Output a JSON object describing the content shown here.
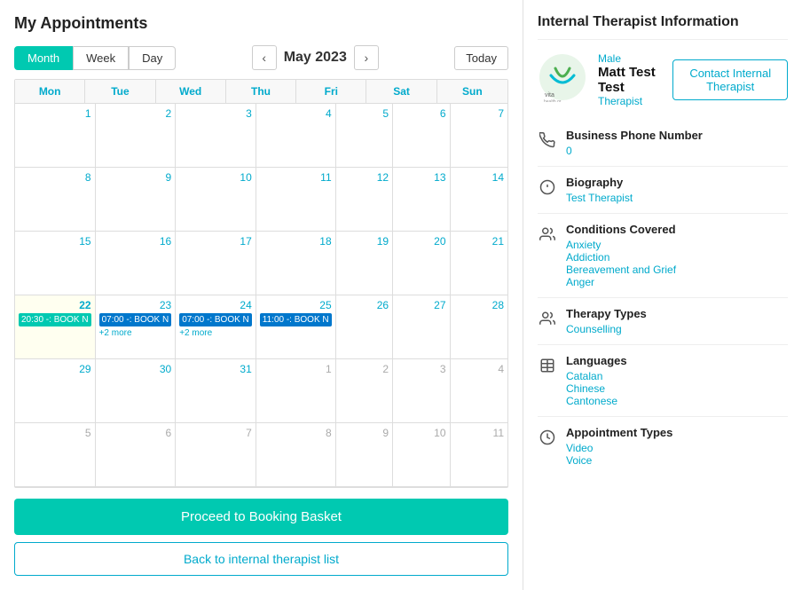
{
  "left": {
    "title": "My Appointments",
    "views": [
      "Month",
      "Week",
      "Day"
    ],
    "active_view": "Month",
    "month_label": "May 2023",
    "nav": {
      "prev": "‹",
      "next": "›",
      "today": "Today"
    },
    "days_header": [
      "Mon",
      "Tue",
      "Wed",
      "Thu",
      "Fri",
      "Sat",
      "Sun"
    ],
    "weeks": [
      [
        {
          "date": "1",
          "events": [],
          "other": false
        },
        {
          "date": "2",
          "events": [],
          "other": false
        },
        {
          "date": "3",
          "events": [],
          "other": false
        },
        {
          "date": "4",
          "events": [],
          "other": false
        },
        {
          "date": "5",
          "events": [],
          "other": false
        },
        {
          "date": "6",
          "events": [],
          "other": false
        },
        {
          "date": "7",
          "events": [],
          "other": false
        }
      ],
      [
        {
          "date": "8",
          "events": [],
          "other": false
        },
        {
          "date": "9",
          "events": [],
          "other": false
        },
        {
          "date": "10",
          "events": [],
          "other": false
        },
        {
          "date": "11",
          "events": [],
          "other": false
        },
        {
          "date": "12",
          "events": [],
          "other": false
        },
        {
          "date": "13",
          "events": [],
          "other": false
        },
        {
          "date": "14",
          "events": [],
          "other": false
        }
      ],
      [
        {
          "date": "15",
          "events": [],
          "other": false
        },
        {
          "date": "16",
          "events": [],
          "other": false
        },
        {
          "date": "17",
          "events": [],
          "other": false
        },
        {
          "date": "18",
          "events": [],
          "other": false
        },
        {
          "date": "19",
          "events": [],
          "other": false
        },
        {
          "date": "20",
          "events": [],
          "other": false
        },
        {
          "date": "21",
          "events": [],
          "other": false
        }
      ],
      [
        {
          "date": "22",
          "today": true,
          "events": [
            {
              "label": "20:30 -: BOOK N",
              "color": "teal"
            }
          ],
          "other": false
        },
        {
          "date": "23",
          "events": [
            {
              "label": "07:00 -: BOOK N",
              "color": "blue"
            }
          ],
          "more": "+2 more",
          "other": false
        },
        {
          "date": "24",
          "events": [
            {
              "label": "07:00 -: BOOK N",
              "color": "blue"
            }
          ],
          "more": "+2 more",
          "other": false
        },
        {
          "date": "25",
          "events": [
            {
              "label": "11:00 -: BOOK N",
              "color": "blue"
            }
          ],
          "other": false
        },
        {
          "date": "26",
          "events": [],
          "other": false
        },
        {
          "date": "27",
          "events": [],
          "other": false
        },
        {
          "date": "28",
          "events": [],
          "other": false
        }
      ],
      [
        {
          "date": "29",
          "events": [],
          "other": false
        },
        {
          "date": "30",
          "events": [],
          "other": false
        },
        {
          "date": "31",
          "events": [],
          "other": false
        },
        {
          "date": "1",
          "events": [],
          "other": true
        },
        {
          "date": "2",
          "events": [],
          "other": true
        },
        {
          "date": "3",
          "events": [],
          "other": true
        },
        {
          "date": "4",
          "events": [],
          "other": true
        }
      ],
      [
        {
          "date": "5",
          "events": [],
          "other": true
        },
        {
          "date": "6",
          "events": [],
          "other": true
        },
        {
          "date": "7",
          "events": [],
          "other": true
        },
        {
          "date": "8",
          "events": [],
          "other": true
        },
        {
          "date": "9",
          "events": [],
          "other": true
        },
        {
          "date": "10",
          "events": [],
          "other": true
        },
        {
          "date": "11",
          "events": [],
          "other": true
        }
      ]
    ],
    "buttons": {
      "booking": "Proceed to Booking Basket",
      "back": "Back to internal therapist list"
    }
  },
  "right": {
    "title": "Internal Therapist Information",
    "therapist": {
      "gender": "Male",
      "name": "Matt Test Test",
      "role": "Therapist",
      "contact_btn": "Contact Internal Therapist"
    },
    "sections": [
      {
        "icon": "phone",
        "label": "Business Phone Number",
        "values": [
          "0"
        ]
      },
      {
        "icon": "info",
        "label": "Biography",
        "values": [
          "Test Therapist"
        ]
      },
      {
        "icon": "conditions",
        "label": "Conditions Covered",
        "values": [
          "Anxiety",
          "Addiction",
          "Bereavement and Grief",
          "Anger"
        ]
      },
      {
        "icon": "therapy",
        "label": "Therapy Types",
        "values": [
          "Counselling"
        ]
      },
      {
        "icon": "language",
        "label": "Languages",
        "values": [
          "Catalan",
          "Chinese",
          "Cantonese"
        ]
      },
      {
        "icon": "appointment",
        "label": "Appointment Types",
        "values": [
          "Video",
          "Voice"
        ]
      }
    ]
  }
}
